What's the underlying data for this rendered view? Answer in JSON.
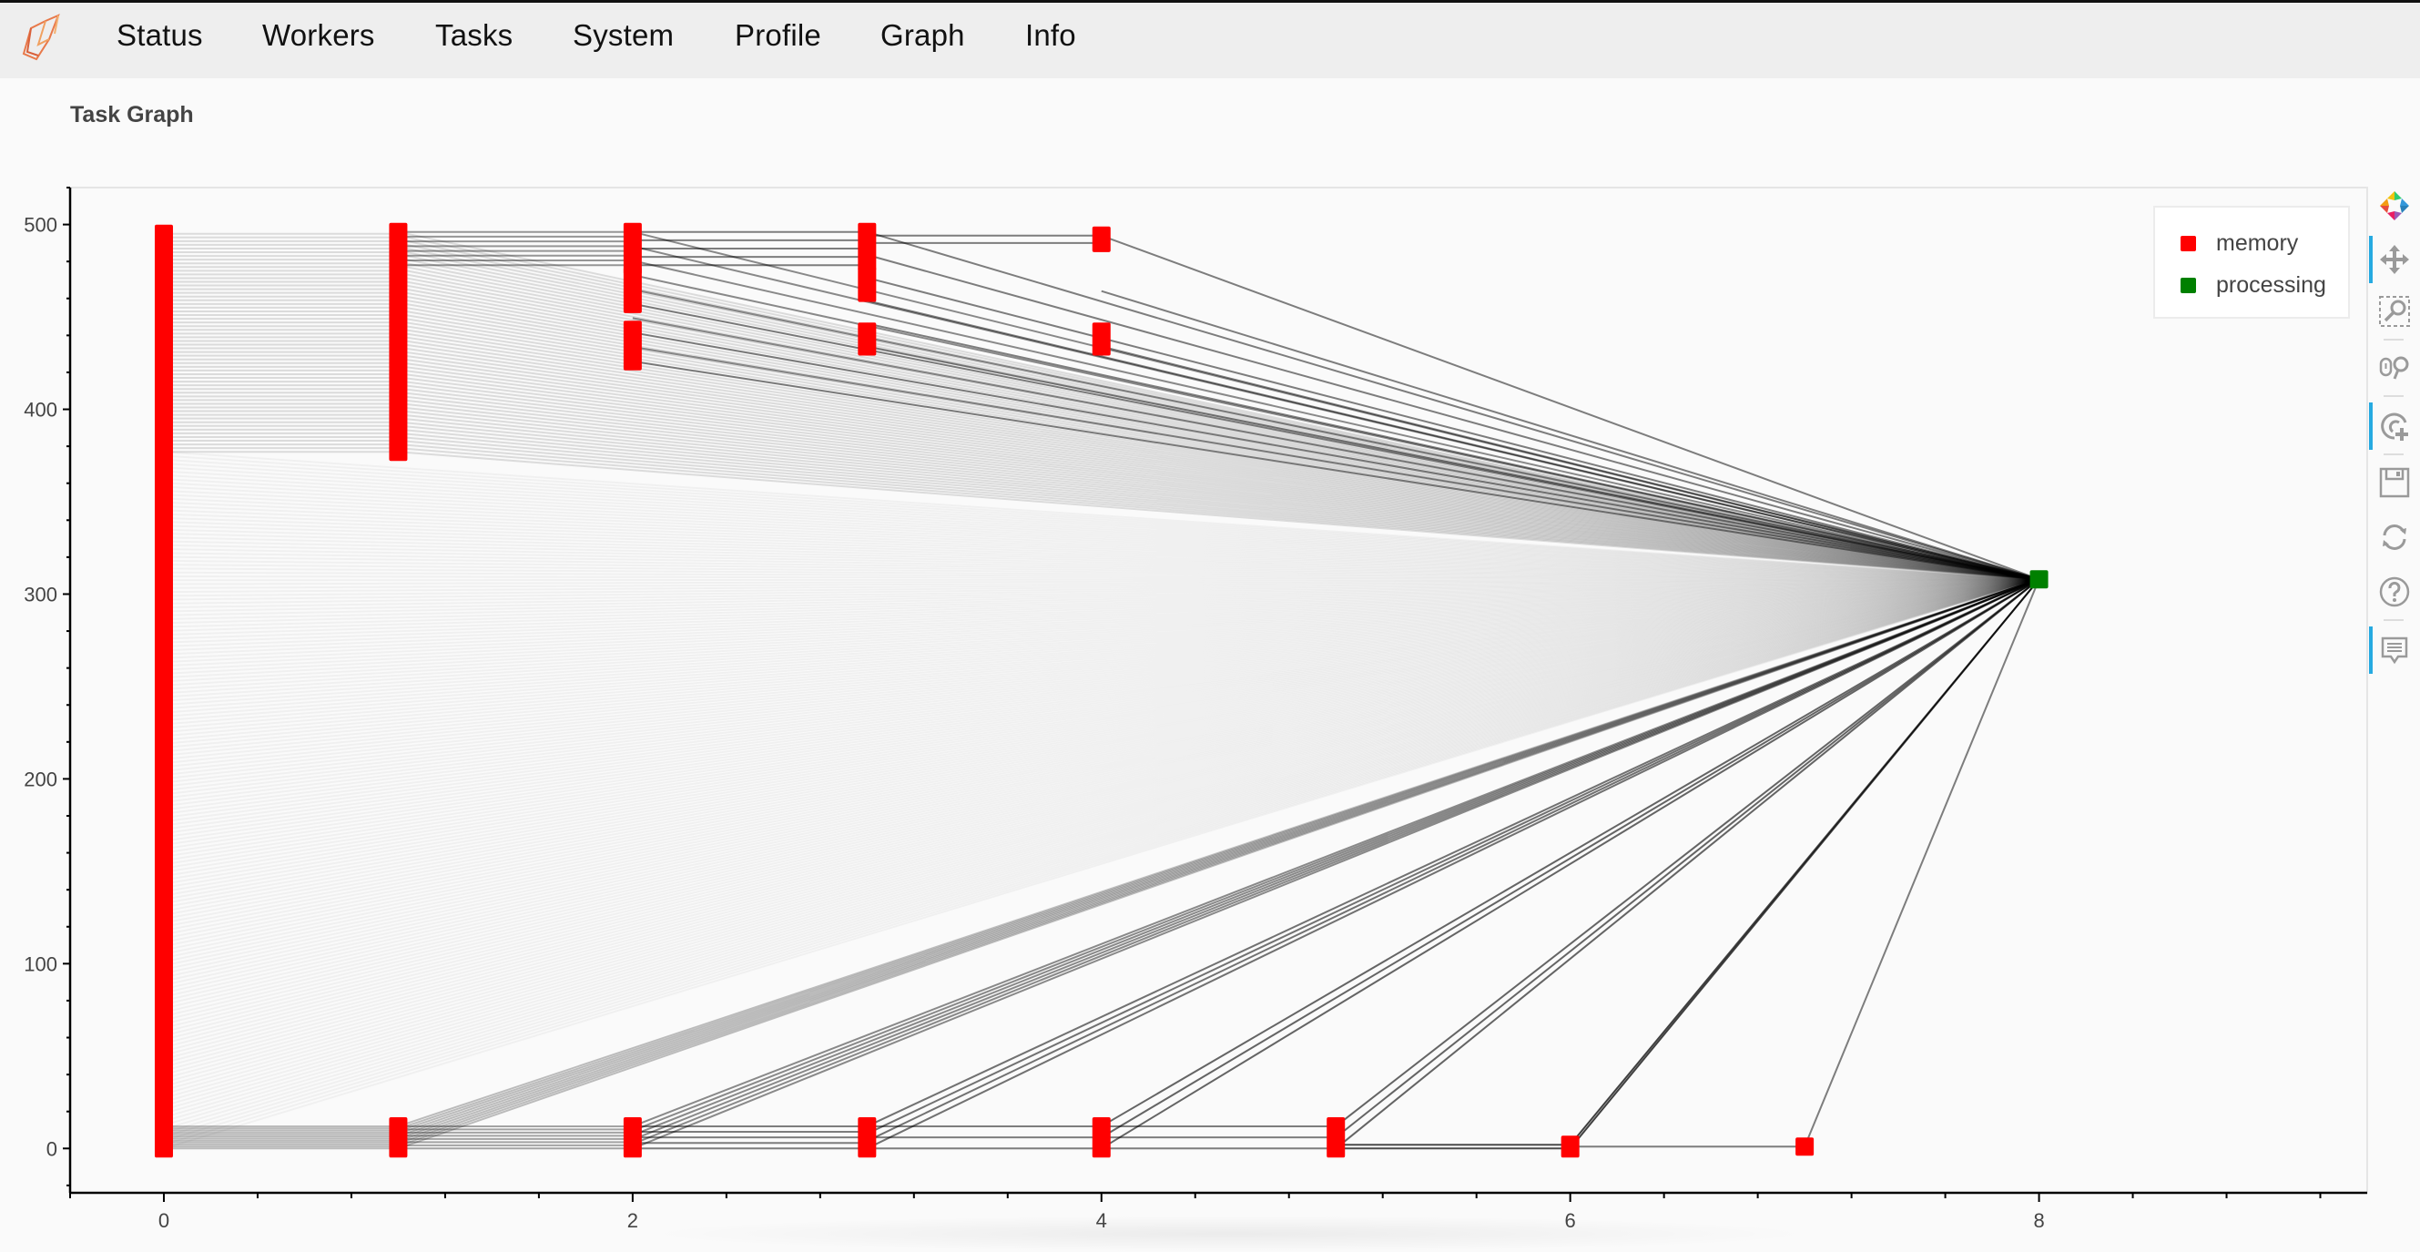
{
  "navbar": {
    "logo_icon": "dask-logo-icon",
    "items": [
      {
        "label": "Status"
      },
      {
        "label": "Workers"
      },
      {
        "label": "Tasks"
      },
      {
        "label": "System"
      },
      {
        "label": "Profile"
      },
      {
        "label": "Graph"
      },
      {
        "label": "Info"
      }
    ]
  },
  "page": {
    "title": "Task Graph"
  },
  "legend": {
    "items": [
      {
        "label": "memory",
        "color": "#ff0000"
      },
      {
        "label": "processing",
        "color": "#008000"
      }
    ]
  },
  "toolbar": {
    "tools": [
      {
        "icon": "bokeh-logo-icon",
        "active": false
      },
      {
        "icon": "pan-icon",
        "active": true
      },
      {
        "icon": "box-zoom-icon",
        "active": false
      },
      {
        "icon": "wheel-zoom-icon",
        "active": false
      },
      {
        "icon": "tap-icon",
        "active": true
      },
      {
        "icon": "save-icon",
        "active": false
      },
      {
        "icon": "reset-icon",
        "active": false
      },
      {
        "icon": "help-icon",
        "active": false
      },
      {
        "icon": "hover-icon",
        "active": true
      }
    ]
  },
  "chart_data": {
    "type": "scatter",
    "title": "Task Graph",
    "xlabel": "",
    "ylabel": "",
    "xlim": [
      -0.4,
      9.4
    ],
    "ylim": [
      -24,
      520
    ],
    "x_ticks": [
      0,
      2,
      4,
      6,
      8
    ],
    "y_ticks": [
      0,
      100,
      200,
      300,
      400,
      500
    ],
    "grid": false,
    "legend_position": "top-right",
    "state_colors": {
      "memory": "#ff0000",
      "processing": "#008000"
    },
    "node_columns": [
      {
        "x": 0,
        "state": "memory",
        "y_ranges": [
          [
            0,
            495
          ]
        ]
      },
      {
        "x": 1,
        "state": "memory",
        "y_ranges": [
          [
            0,
            12
          ],
          [
            377,
            496
          ]
        ]
      },
      {
        "x": 2,
        "state": "memory",
        "y_ranges": [
          [
            0,
            12
          ],
          [
            426,
            443
          ],
          [
            457,
            472
          ],
          [
            478,
            496
          ]
        ]
      },
      {
        "x": 3,
        "state": "memory",
        "y_ranges": [
          [
            0,
            12
          ],
          [
            434,
            442
          ],
          [
            463,
            472
          ],
          [
            480,
            496
          ]
        ]
      },
      {
        "x": 4,
        "state": "memory",
        "y_ranges": [
          [
            0,
            12
          ],
          [
            434,
            442
          ],
          [
            490,
            494
          ]
        ]
      },
      {
        "x": 5,
        "state": "memory",
        "y_ranges": [
          [
            0,
            12
          ]
        ]
      },
      {
        "x": 6,
        "state": "memory",
        "y_ranges": [
          [
            0,
            2
          ]
        ]
      },
      {
        "x": 7,
        "state": "memory",
        "y_ranges": [
          [
            1,
            1
          ]
        ]
      },
      {
        "x": 8,
        "state": "processing",
        "y_ranges": [
          [
            308,
            308
          ]
        ]
      }
    ],
    "edge_groups": [
      {
        "from_x": 0,
        "from_y": [
          0,
          377
        ],
        "to_x": 8,
        "to_y": 308,
        "count": 180,
        "alpha": 0.04
      },
      {
        "from_x": 0,
        "from_y": [
          377,
          495
        ],
        "to_x": 1,
        "to_y_same": true,
        "count": 60,
        "alpha": 0.12
      },
      {
        "from_x": 1,
        "from_y": [
          377,
          496
        ],
        "to_x": 8,
        "to_y": 308,
        "count": 60,
        "alpha": 0.12
      },
      {
        "from_x": 0,
        "from_y": [
          0,
          12
        ],
        "to_x": 1,
        "to_y_same": true,
        "count": 12,
        "alpha": 0.25
      },
      {
        "from_x": 1,
        "from_y": [
          0,
          12
        ],
        "to_x": 8,
        "to_y": 308,
        "count": 10,
        "alpha": 0.25
      },
      {
        "from_x": 1,
        "from_y": [
          478,
          496
        ],
        "to_x": 2,
        "to_y_same": true,
        "count": 8,
        "alpha": 0.4
      },
      {
        "from_x": 1,
        "from_y": [
          0,
          12
        ],
        "to_x": 2,
        "to_y_same": true,
        "count": 8,
        "alpha": 0.35
      },
      {
        "from_x": 2,
        "from_y": [
          0,
          12
        ],
        "to_x": 8,
        "to_y": 308,
        "count": 6,
        "alpha": 0.45
      },
      {
        "from_x": 2,
        "from_y": [
          426,
          496
        ],
        "to_x": 8,
        "to_y": 308,
        "count": 10,
        "alpha": 0.45
      },
      {
        "from_x": 2,
        "from_y": [
          478,
          496
        ],
        "to_x": 3,
        "to_y_same": true,
        "count": 5,
        "alpha": 0.5
      },
      {
        "from_x": 2,
        "from_y": [
          0,
          12
        ],
        "to_x": 3,
        "to_y_same": true,
        "count": 5,
        "alpha": 0.5
      },
      {
        "from_x": 3,
        "from_y": [
          0,
          12
        ],
        "to_x": 8,
        "to_y": 308,
        "count": 4,
        "alpha": 0.55
      },
      {
        "from_x": 3,
        "from_y": [
          434,
          496
        ],
        "to_x": 8,
        "to_y": 308,
        "count": 6,
        "alpha": 0.5
      },
      {
        "from_x": 3,
        "from_y": [
          490,
          494
        ],
        "to_x": 4,
        "to_y_same": true,
        "count": 2,
        "alpha": 0.5
      },
      {
        "from_x": 3,
        "from_y": [
          0,
          12
        ],
        "to_x": 4,
        "to_y_same": true,
        "count": 3,
        "alpha": 0.5
      },
      {
        "from_x": 4,
        "from_y": [
          0,
          12
        ],
        "to_x": 8,
        "to_y": 308,
        "count": 3,
        "alpha": 0.6
      },
      {
        "from_x": 4,
        "from_y": [
          434,
          494
        ],
        "to_x": 8,
        "to_y": 308,
        "count": 3,
        "alpha": 0.5
      },
      {
        "from_x": 4,
        "from_y": [
          0,
          12
        ],
        "to_x": 5,
        "to_y_same": true,
        "count": 3,
        "alpha": 0.5
      },
      {
        "from_x": 5,
        "from_y": [
          0,
          12
        ],
        "to_x": 8,
        "to_y": 308,
        "count": 3,
        "alpha": 0.6
      },
      {
        "from_x": 5,
        "from_y": [
          0,
          2
        ],
        "to_x": 6,
        "to_y_same": true,
        "count": 2,
        "alpha": 0.7
      },
      {
        "from_x": 6,
        "from_y": [
          0,
          2
        ],
        "to_x": 8,
        "to_y": 308,
        "count": 2,
        "alpha": 0.75
      },
      {
        "from_x": 6,
        "from_y": [
          1,
          1
        ],
        "to_x": 7,
        "to_y_same": true,
        "count": 1,
        "alpha": 0.5
      },
      {
        "from_x": 7,
        "from_y": [
          1,
          1
        ],
        "to_x": 8,
        "to_y": 308,
        "count": 1,
        "alpha": 0.5
      }
    ]
  }
}
